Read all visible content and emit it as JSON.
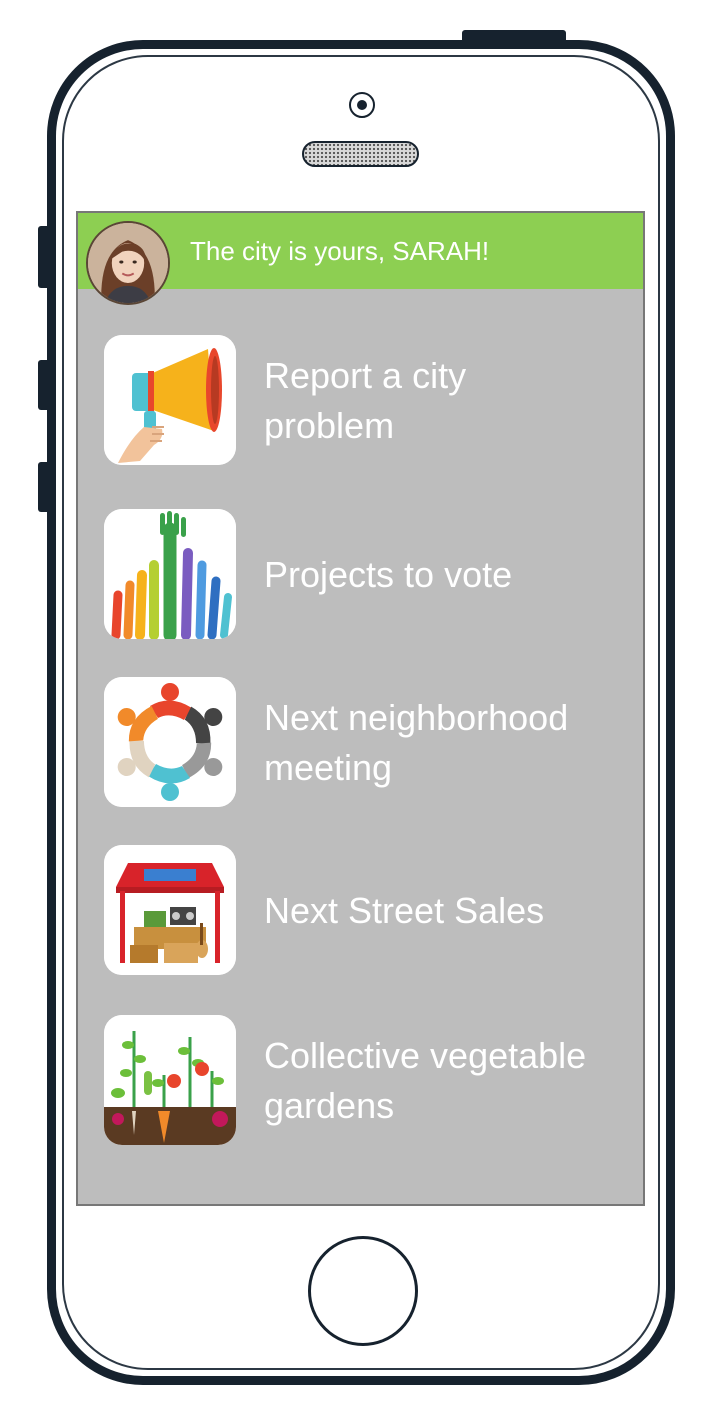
{
  "header": {
    "greeting": "The city is yours, SARAH!",
    "avatar_icon": "user-avatar",
    "bar_color": "#8dcf52"
  },
  "menu": [
    {
      "label": "Report a city problem",
      "icon": "megaphone-icon"
    },
    {
      "label": "Projects to vote",
      "icon": "raised-hands-icon"
    },
    {
      "label": "Next neighborhood meeting",
      "icon": "community-circle-icon"
    },
    {
      "label": "Next Street Sales",
      "icon": "market-stall-icon"
    },
    {
      "label": "Collective vegetable gardens",
      "icon": "vegetable-garden-icon"
    }
  ],
  "colors": {
    "screen_bg": "#bdbdbd",
    "phone_frame": "#16222e",
    "text": "#ffffff"
  }
}
